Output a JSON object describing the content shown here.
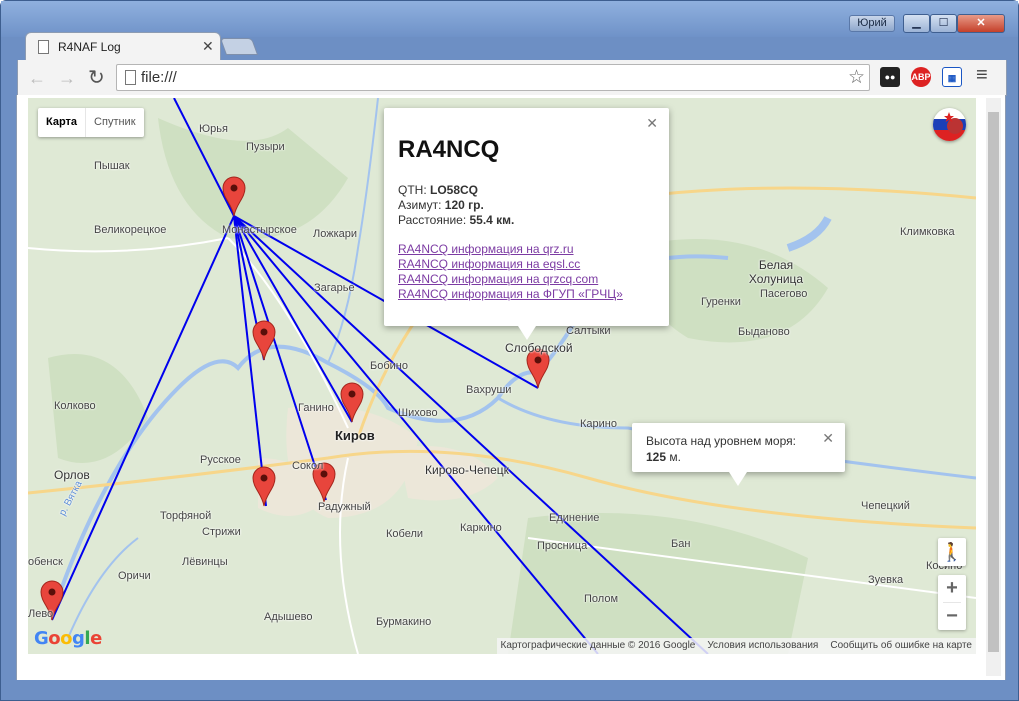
{
  "window": {
    "user_label": "Юрий",
    "min_glyph": "▁",
    "max_glyph": "☐",
    "close_glyph": "✕"
  },
  "tab": {
    "title": "R4NAF Log",
    "close_glyph": "✕"
  },
  "toolbar": {
    "back_glyph": "←",
    "forward_glyph": "→",
    "reload_glyph": "↻",
    "url": "file:///",
    "star_glyph": "☆",
    "abp_label": "ABP",
    "menu_glyph": "≡"
  },
  "map": {
    "type_map": "Карта",
    "type_satellite": "Спутник",
    "places": [
      {
        "name": "Юрья",
        "cls": ""
      },
      {
        "name": "Пузыри",
        "cls": ""
      },
      {
        "name": "Пышак",
        "cls": ""
      },
      {
        "name": "Великорецкое",
        "cls": ""
      },
      {
        "name": "Монастырское",
        "cls": ""
      },
      {
        "name": "Ложкари",
        "cls": ""
      },
      {
        "name": "Загарье",
        "cls": ""
      },
      {
        "name": "Слободской",
        "cls": "mid"
      },
      {
        "name": "Салтыки",
        "cls": ""
      },
      {
        "name": "Бобино",
        "cls": ""
      },
      {
        "name": "Вахруши",
        "cls": ""
      },
      {
        "name": "Колково",
        "cls": ""
      },
      {
        "name": "Ганино",
        "cls": ""
      },
      {
        "name": "Шихово",
        "cls": ""
      },
      {
        "name": "Киров",
        "cls": "big"
      },
      {
        "name": "Русское",
        "cls": ""
      },
      {
        "name": "Сокол",
        "cls": ""
      },
      {
        "name": "Кирово-Чепецк",
        "cls": "mid"
      },
      {
        "name": "Орлов",
        "cls": "mid"
      },
      {
        "name": "Торфяной",
        "cls": ""
      },
      {
        "name": "Стрижи",
        "cls": ""
      },
      {
        "name": "Радужный",
        "cls": ""
      },
      {
        "name": "Кобели",
        "cls": ""
      },
      {
        "name": "Каркино",
        "cls": ""
      },
      {
        "name": "Единение",
        "cls": ""
      },
      {
        "name": "Просница",
        "cls": ""
      },
      {
        "name": "Лёвинцы",
        "cls": ""
      },
      {
        "name": "Оричи",
        "cls": ""
      },
      {
        "name": "Полом",
        "cls": ""
      },
      {
        "name": "Адышево",
        "cls": ""
      },
      {
        "name": "Бурмакино",
        "cls": ""
      },
      {
        "name": "Лево",
        "cls": ""
      },
      {
        "name": "обенск",
        "cls": ""
      },
      {
        "name": "Климковка",
        "cls": ""
      },
      {
        "name": "Белая Холуница",
        "cls": "mid"
      },
      {
        "name": "Пасегово",
        "cls": ""
      },
      {
        "name": "Гуренки",
        "cls": ""
      },
      {
        "name": "Быданово",
        "cls": ""
      },
      {
        "name": "Карино",
        "cls": ""
      },
      {
        "name": "Чепецкий",
        "cls": ""
      },
      {
        "name": "Бан",
        "cls": ""
      },
      {
        "name": "Косино",
        "cls": ""
      },
      {
        "name": "Зуевка",
        "cls": ""
      },
      {
        "name": "р. Вятка",
        "cls": "river"
      }
    ],
    "google_logo": "Google",
    "attribution": [
      "Картографические данные © 2016 Google",
      "Условия использования",
      "Сообщить об ошибке на карте"
    ],
    "zoom_in": "+",
    "zoom_out": "−",
    "pegman": "🚶"
  },
  "station_popup": {
    "callsign": "RA4NCQ",
    "close_glyph": "✕",
    "qth_label": "QTH: ",
    "qth_value": "LO58CQ",
    "azimuth_label": "Азимут: ",
    "azimuth_value": "120 гр.",
    "distance_label": "Расстояние: ",
    "distance_value": "55.4 км.",
    "links": [
      "RA4NCQ информация на qrz.ru",
      "RA4NCQ информация на eqsl.cc",
      "RA4NCQ информация на qrzcq.com",
      "RA4NCQ информация на ФГУП «ГРЧЦ»"
    ]
  },
  "elevation_popup": {
    "label": "Высота над уровнем моря: ",
    "value": "125",
    "unit": " м.",
    "close_glyph": "✕"
  },
  "colors": {
    "line": "#0000ee",
    "marker": "#e8453c",
    "marker_dark": "#a4261c",
    "water": "#a3c3ee",
    "park": "#c8dcb8",
    "urban": "#efe9dc",
    "road": "#ffffff",
    "road_major": "#f7d68a"
  }
}
